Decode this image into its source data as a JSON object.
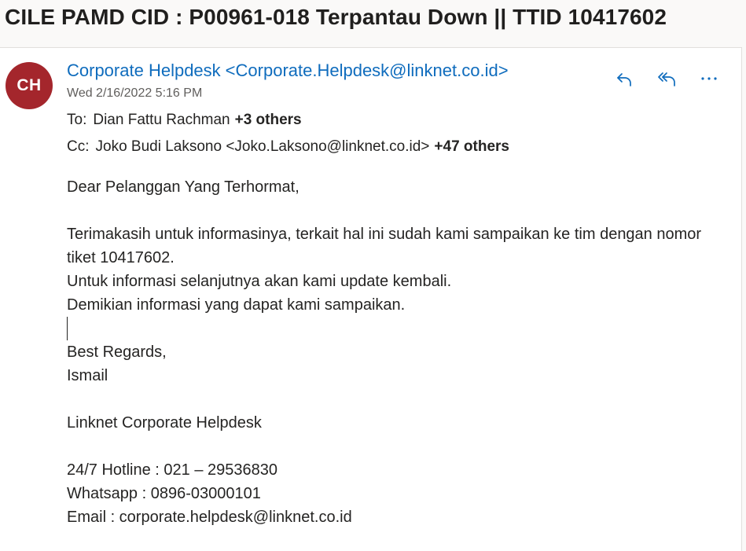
{
  "subject": "CILE PAMD CID : P00961-018 Terpantau Down || TTID 10417602",
  "sender": {
    "initials": "CH",
    "name": "Corporate Helpdesk",
    "email": "<Corporate.Helpdesk@linknet.co.id>",
    "date": "Wed 2/16/2022 5:16 PM",
    "avatar_color": "#a4262c"
  },
  "recipients": {
    "to_label": "To:",
    "to_name": "Dian Fattu Rachman",
    "to_more": "+3 others",
    "cc_label": "Cc:",
    "cc_name": "Joko Budi Laksono <Joko.Laksono@linknet.co.id>",
    "cc_more": "+47 others"
  },
  "actions": {
    "reply_icon": "reply-icon",
    "reply_all_icon": "reply-all-icon",
    "more_icon": "more-actions-icon"
  },
  "body": {
    "greeting": "Dear Pelanggan Yang Terhormat,",
    "para1": "Terimakasih untuk informasinya, terkait hal ini sudah kami sampaikan ke tim dengan nomor tiket 10417602.",
    "para2": "Untuk informasi selanjutnya akan kami update kembali.",
    "para3": "Demikian informasi yang dapat kami sampaikan.",
    "regards": "Best Regards,",
    "signer": "Ismail",
    "org": "Linknet Corporate Helpdesk",
    "hotline": "24/7 Hotline : 021 – 29536830",
    "whatsapp": "Whatsapp : 0896-03000101",
    "email": "Email  : corporate.helpdesk@linknet.co.id"
  },
  "colors": {
    "accent": "#0f6cbd",
    "text": "#252423",
    "muted": "#605e5c"
  }
}
